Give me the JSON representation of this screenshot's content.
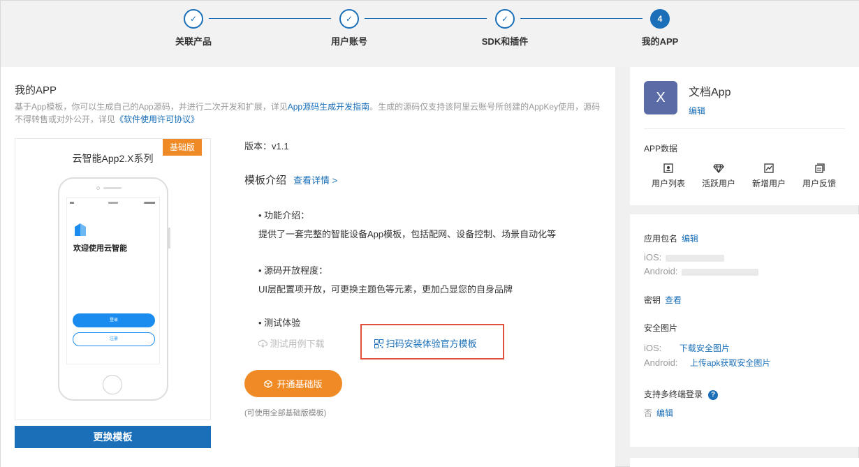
{
  "steps": [
    {
      "label": "关联产品",
      "state": "done"
    },
    {
      "label": "用户账号",
      "state": "done"
    },
    {
      "label": "SDK和插件",
      "state": "done"
    },
    {
      "label": "我的APP",
      "state": "current",
      "number": "4"
    }
  ],
  "main": {
    "title": "我的APP",
    "desc_1": "基于App模板，你可以生成自己的App源码，并进行二次开发和扩展，详见",
    "desc_link_1": "App源码生成开发指南",
    "desc_2": "。生成的源码仅支持该阿里云账号所创建的AppKey使用，源码不得转售或对外公开，详见",
    "desc_link_2": "《软件使用许可协议》",
    "preview": {
      "title": "云智能App2.X系列",
      "badge": "基础版",
      "phone_welcome": "欢迎使用云智能",
      "phone_login": "登录",
      "phone_register": "注册"
    },
    "change_template": "更换模板",
    "version": "版本：v1.1",
    "intro_title": "模板介绍",
    "intro_link": "查看详情 >",
    "features": [
      {
        "heading": "• 功能介绍：",
        "text": "提供了一套完整的智能设备App模板，包括配网、设备控制、场景自动化等"
      },
      {
        "heading": "• 源码开放程度：",
        "text": "UI层配置项开放，可更换主题色等元素，更加凸显您的自身品牌"
      },
      {
        "heading": "• 测试体验",
        "text": ""
      }
    ],
    "download_test": "测试用例下载",
    "scan_install": "扫码安装体验官方模板",
    "open_basic": "开通基础版",
    "note": "(可使用全部基础版模板)"
  },
  "right": {
    "app_icon": "X",
    "app_name": "文档App",
    "edit": "编辑",
    "data_title": "APP数据",
    "data_items": [
      "用户列表",
      "活跃用户",
      "新增用户",
      "用户反馈"
    ],
    "package_label": "应用包名",
    "package_edit": "编辑",
    "ios_label": "iOS:",
    "android_label": "Android:",
    "secret_label": "密钥",
    "secret_view": "查看",
    "security_label": "安全图片",
    "sec_ios_label": "iOS:",
    "sec_ios_link": "下载安全图片",
    "sec_android_label": "Android:",
    "sec_android_link": "上传apk获取安全图片",
    "multi_login_label": "支持多终端登录",
    "multi_login_value": "否",
    "multi_login_edit": "编辑",
    "help": "?"
  }
}
